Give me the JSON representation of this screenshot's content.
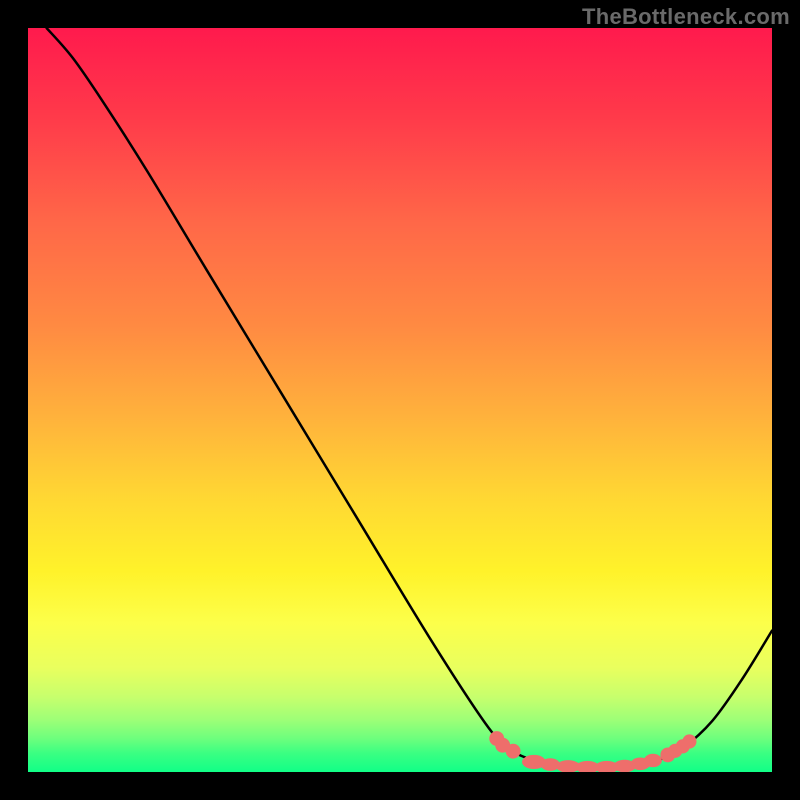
{
  "watermark": "TheBottleneck.com",
  "chart_data": {
    "type": "line",
    "title": "",
    "xlabel": "",
    "ylabel": "",
    "x_range": [
      0,
      100
    ],
    "y_range": [
      0,
      100
    ],
    "note": "Axes not shown; values are relative percentages of plot width/height. y is bottleneck percentage (0 at bottom, 100 at top).",
    "curve": {
      "name": "bottleneck-curve",
      "points": [
        {
          "x": 2.5,
          "y": 100
        },
        {
          "x": 6.0,
          "y": 96.0
        },
        {
          "x": 10.0,
          "y": 90.2
        },
        {
          "x": 16.0,
          "y": 80.8
        },
        {
          "x": 24.0,
          "y": 67.5
        },
        {
          "x": 34.0,
          "y": 51.0
        },
        {
          "x": 44.0,
          "y": 34.5
        },
        {
          "x": 54.0,
          "y": 18.0
        },
        {
          "x": 61.5,
          "y": 6.5
        },
        {
          "x": 64.5,
          "y": 3.3
        },
        {
          "x": 67.0,
          "y": 1.9
        },
        {
          "x": 71.0,
          "y": 0.9
        },
        {
          "x": 75.0,
          "y": 0.6
        },
        {
          "x": 79.0,
          "y": 0.6
        },
        {
          "x": 82.5,
          "y": 1.1
        },
        {
          "x": 85.0,
          "y": 1.7
        },
        {
          "x": 88.0,
          "y": 3.2
        },
        {
          "x": 92.0,
          "y": 6.9
        },
        {
          "x": 96.0,
          "y": 12.5
        },
        {
          "x": 100.0,
          "y": 19.0
        }
      ]
    },
    "marker_cluster": {
      "name": "optimal-zone-markers",
      "color": "#ee6e6b",
      "points": [
        {
          "x": 63.0,
          "y": 4.5,
          "r": 1.0
        },
        {
          "x": 63.8,
          "y": 3.6,
          "r": 1.0
        },
        {
          "x": 65.2,
          "y": 2.8,
          "r": 1.0
        },
        {
          "x": 68.0,
          "y": 1.35,
          "rx": 1.6,
          "ry": 0.95
        },
        {
          "x": 70.2,
          "y": 1.0,
          "rx": 1.3,
          "ry": 0.85
        },
        {
          "x": 72.6,
          "y": 0.75,
          "rx": 1.6,
          "ry": 0.85
        },
        {
          "x": 75.2,
          "y": 0.65,
          "rx": 1.6,
          "ry": 0.85
        },
        {
          "x": 77.8,
          "y": 0.65,
          "rx": 1.6,
          "ry": 0.85
        },
        {
          "x": 80.2,
          "y": 0.8,
          "rx": 1.5,
          "ry": 0.85
        },
        {
          "x": 82.3,
          "y": 1.1,
          "rx": 1.3,
          "ry": 0.85
        },
        {
          "x": 84.0,
          "y": 1.55,
          "rx": 1.2,
          "ry": 0.9
        },
        {
          "x": 86.0,
          "y": 2.3,
          "r": 1.0
        },
        {
          "x": 87.0,
          "y": 2.85,
          "r": 0.95
        },
        {
          "x": 88.0,
          "y": 3.45,
          "r": 0.95
        },
        {
          "x": 88.9,
          "y": 4.1,
          "r": 0.95
        }
      ]
    }
  }
}
